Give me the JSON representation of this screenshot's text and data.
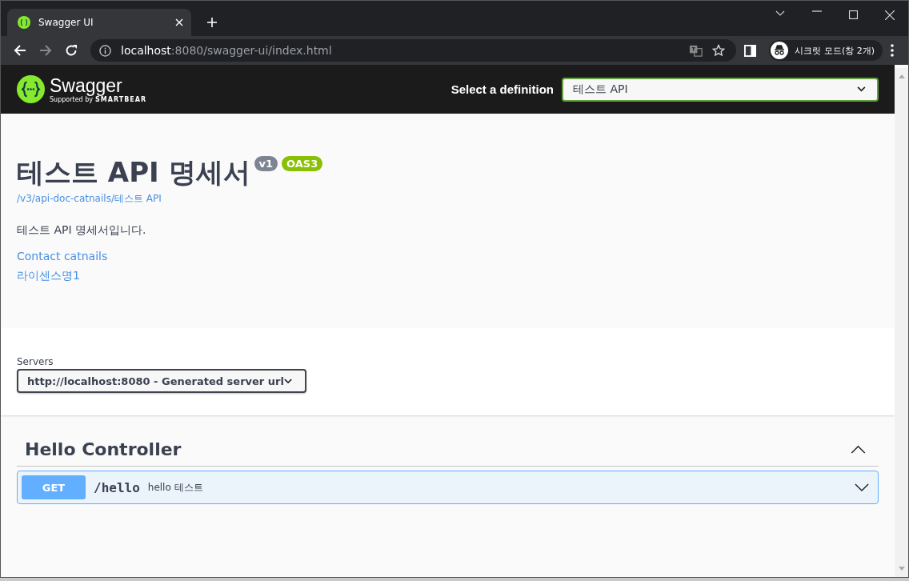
{
  "browser": {
    "tabs": [
      {
        "title": "Swagger UI",
        "selected": true
      }
    ],
    "url": {
      "host": "localhost",
      "rest": ":8080/swagger-ui/index.html"
    },
    "profile": "시크릿 모드(창 2개)"
  },
  "topbar": {
    "logo_text": "Swagger",
    "logo_sub": "Supported by",
    "logo_brand": "SMARTBEAR",
    "definition_label": "Select a definition",
    "definition_value": "테스트 API"
  },
  "info": {
    "title": "테스트 API 명세서",
    "badges": [
      {
        "text": "v1",
        "color": "#7d8492"
      },
      {
        "text": "OAS3",
        "color": "#89bf04"
      }
    ],
    "spec_link": "/v3/api-doc-catnails/테스트 API",
    "description": "테스트 API 명세서입니다.",
    "links": [
      "Contact catnails",
      "라이센스명1"
    ]
  },
  "servers": {
    "label": "Servers",
    "value": "http://localhost:8080 - Generated server url"
  },
  "tags": [
    {
      "name": "Hello Controller",
      "expanded": true,
      "operations": [
        {
          "method": "GET",
          "kind": "get",
          "path": "/hello",
          "summary": "hello 테스트",
          "expanded": false
        }
      ]
    }
  ]
}
